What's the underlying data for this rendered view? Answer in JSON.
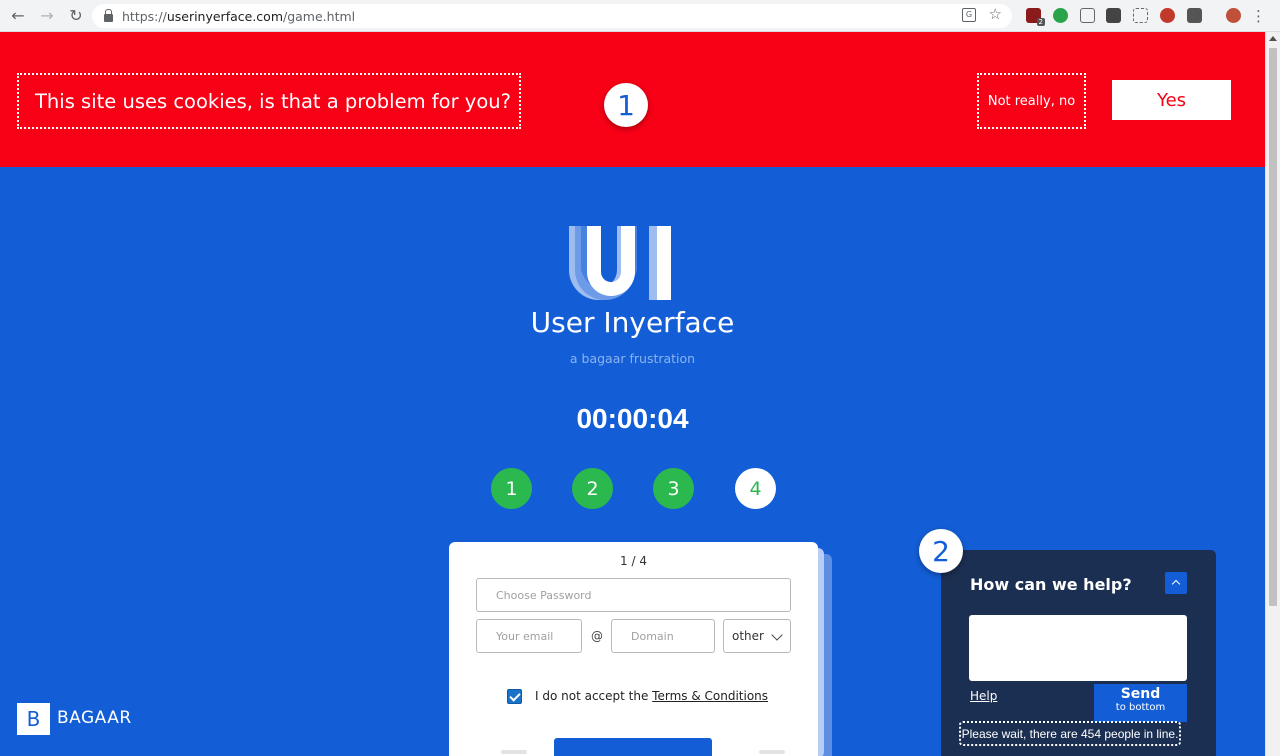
{
  "browser": {
    "url_prefix": "https://",
    "url_host": "userinyerface.com",
    "url_path": "/game.html",
    "back_icon": "arrow-left-icon",
    "forward_icon": "arrow-right-icon",
    "reload_icon": "reload-icon",
    "extension_badge": "2"
  },
  "cookie_banner": {
    "message": "This site uses cookies, is that a problem for you?",
    "decline_label": "Not really, no",
    "accept_label": "Yes",
    "marker": "1",
    "background": "#f80016"
  },
  "header": {
    "title": "User Inyerface",
    "subtitle": "a bagaar frustration",
    "timer": "00:00:04"
  },
  "steps": [
    {
      "label": "1",
      "state": "done"
    },
    {
      "label": "2",
      "state": "done"
    },
    {
      "label": "3",
      "state": "done"
    },
    {
      "label": "4",
      "state": "current"
    }
  ],
  "form": {
    "page_indicator": "1 / 4",
    "password_placeholder": "Choose Password",
    "email_placeholder": "Your email",
    "at_sign": "@",
    "domain_placeholder": "Domain",
    "tld_value": "other",
    "terms_prefix": "I do not accept the ",
    "terms_link": "Terms & Conditions",
    "terms_checked": true
  },
  "help_widget": {
    "marker": "2",
    "title": "How can we help?",
    "help_link": "Help",
    "send_label": "Send",
    "send_sub": "to bottom",
    "wait_text": "Please wait, there are 454 people in line."
  },
  "footer": {
    "brand_letter": "B",
    "brand_name": "BAGAAR"
  },
  "colors": {
    "background": "#135ed6",
    "accent_green": "#2bb84f",
    "help_panel": "#1b2f52"
  }
}
